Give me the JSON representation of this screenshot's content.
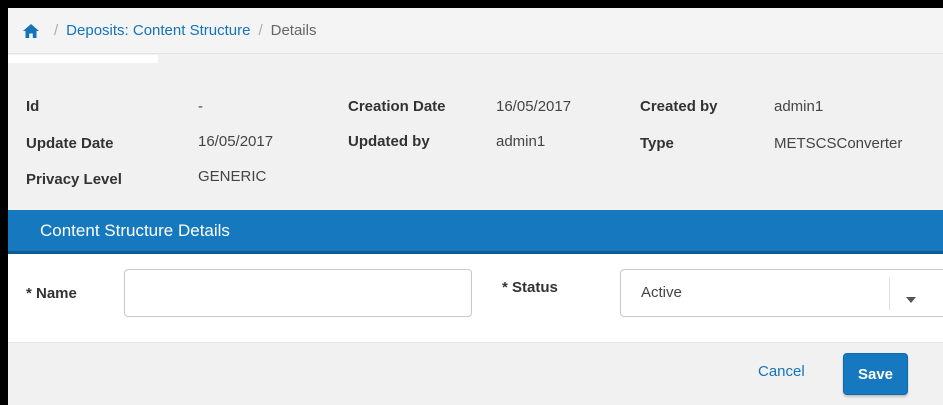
{
  "breadcrumb": {
    "home_icon": "home-icon",
    "items": [
      "Deposits: Content Structure",
      "Details"
    ],
    "separator": "/"
  },
  "meta": {
    "id_label": "Id",
    "id_value": "-",
    "creation_date_label": "Creation Date",
    "creation_date_value": "16/05/2017",
    "created_by_label": "Created by",
    "created_by_value": "admin1",
    "update_date_label": "Update Date",
    "update_date_value": "16/05/2017",
    "updated_by_label": "Updated by",
    "updated_by_value": "admin1",
    "type_label": "Type",
    "type_value": "METSCSConverter",
    "privacy_level_label": "Privacy Level",
    "privacy_level_value": "GENERIC"
  },
  "section": {
    "title": "Content Structure Details"
  },
  "form": {
    "name_label": "* Name",
    "name_value": "",
    "status_label": "* Status",
    "status_value": "Active",
    "caret_icon": "caret-down-icon"
  },
  "actions": {
    "cancel_label": "Cancel",
    "save_label": "Save"
  },
  "colors": {
    "accent": "#1679c0",
    "link": "#1473ba",
    "background": "#f1f1f1"
  }
}
